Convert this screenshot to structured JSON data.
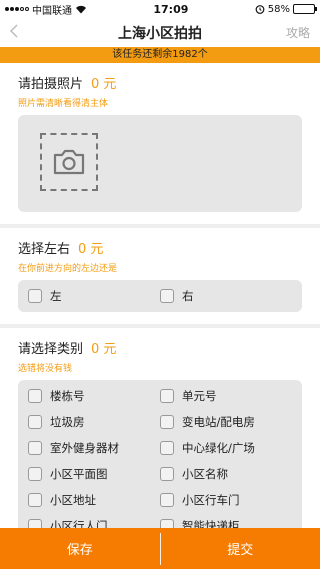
{
  "status_bar": {
    "carrier": "中国联通",
    "time": "17:09",
    "battery": "58%",
    "battery_level": 0.58
  },
  "nav": {
    "back_icon": "chevron-left",
    "title": "上海小区拍拍",
    "right": "攻略"
  },
  "banner": "该任务还剩余1982个",
  "photo_section": {
    "title": "请拍摄照片",
    "price": "0 元",
    "hint": "照片需清晰看得清主体",
    "icon": "camera-icon"
  },
  "side_section": {
    "title": "选择左右",
    "price": "0 元",
    "hint": "在你前进方向的左边还是",
    "options": [
      "左",
      "右"
    ]
  },
  "category_section": {
    "title": "请选择类别",
    "price": "0 元",
    "hint": "选错将没有钱",
    "options": [
      "楼栋号",
      "单元号",
      "垃圾房",
      "变电站/配电房",
      "室外健身器材",
      "中心绿化/广场",
      "小区平面图",
      "小区名称",
      "小区地址",
      "小区行车门",
      "小区行人门",
      "智能快递柜"
    ]
  },
  "bottom": {
    "save": "保存",
    "submit": "提交"
  },
  "colors": {
    "accent": "#f39c12",
    "bottom_bar": "#f57c00"
  }
}
